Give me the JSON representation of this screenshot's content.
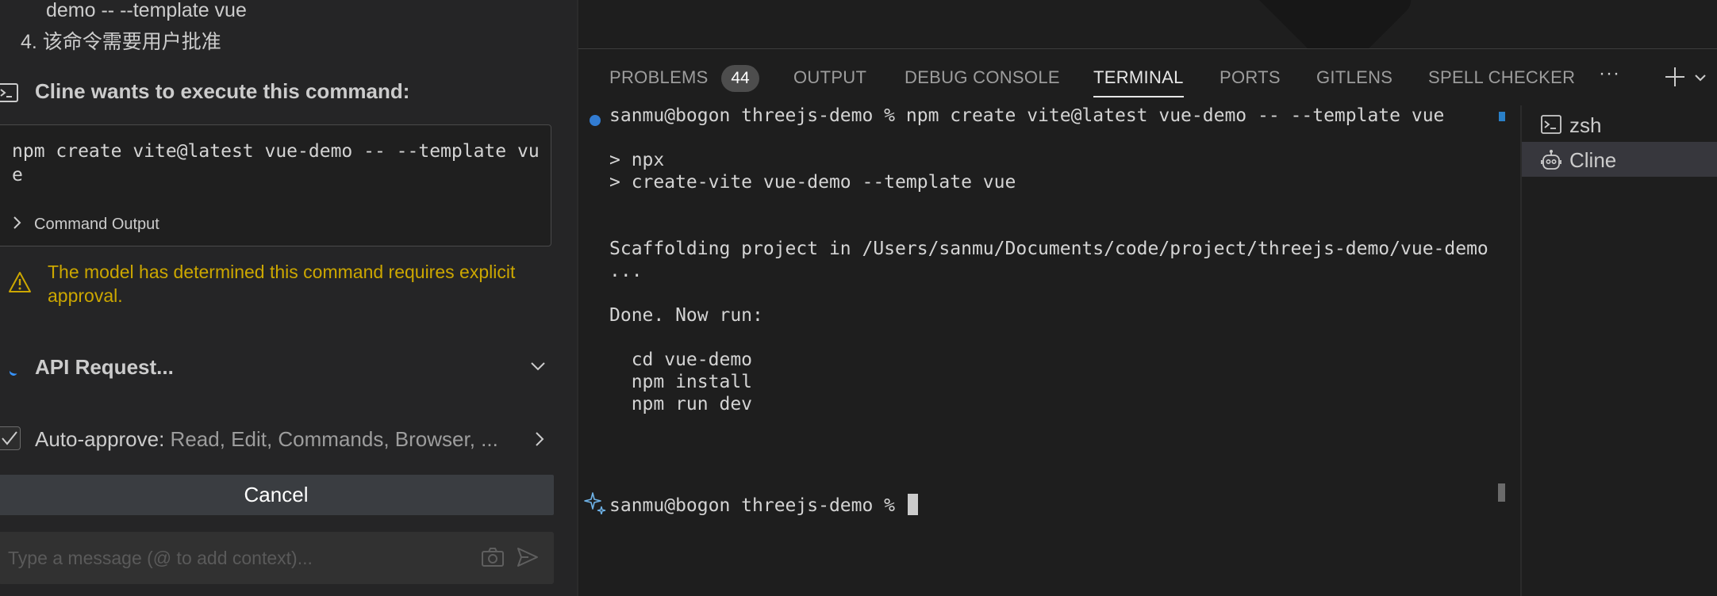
{
  "cline": {
    "prev_line": "demo -- --template vue",
    "step4": "4. 该命令需要用户批准",
    "command_header": "Cline wants to execute this command:",
    "command_text": "npm create vite@latest vue-demo -- --template vue",
    "command_output_label": "Command Output",
    "warning_text": "The model has determined this command requires explicit approval.",
    "api_request_label": "API Request...",
    "auto_approve_key": "Auto-approve:",
    "auto_approve_value": " Read, Edit, Commands, Browser, ...",
    "cancel_label": "Cancel",
    "message_placeholder": "Type a message (@ to add context)..."
  },
  "panel": {
    "tabs": [
      {
        "label": "PROBLEMS",
        "badge": "44"
      },
      {
        "label": "OUTPUT"
      },
      {
        "label": "DEBUG CONSOLE"
      },
      {
        "label": "TERMINAL",
        "active": true
      },
      {
        "label": "PORTS"
      },
      {
        "label": "GITLENS"
      },
      {
        "label": "SPELL CHECKER"
      }
    ],
    "more_label": "···"
  },
  "terminal": {
    "lines": [
      "sanmu@bogon threejs-demo % npm create vite@latest vue-demo -- --template vue",
      "",
      "> npx",
      "> create-vite vue-demo --template vue",
      "",
      "",
      "Scaffolding project in /Users/sanmu/Documents/code/project/threejs-demo/vue-demo",
      "...",
      "",
      "Done. Now run:",
      "",
      "  cd vue-demo",
      "  npm install",
      "  npm run dev",
      "",
      "sanmu@bogon threejs-demo % "
    ]
  },
  "terminal_list": [
    {
      "name": "zsh",
      "icon": "terminal-icon"
    },
    {
      "name": "Cline",
      "icon": "robot-icon",
      "active": true
    }
  ],
  "colors": {
    "warning": "#cca700",
    "accent": "#3794ff",
    "background": "#1e1e1e",
    "sidebar_bg": "#252526"
  }
}
